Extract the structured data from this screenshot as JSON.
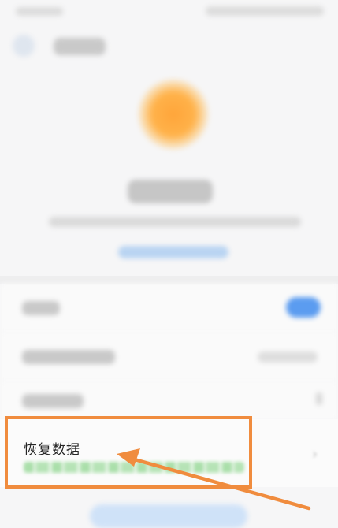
{
  "restore_item": {
    "title": "恢复数据"
  },
  "colors": {
    "accent": "#f08c3e",
    "toggle": "#5b9cf0",
    "sun": "#ffa53a",
    "background": "#f6f6f7"
  },
  "icons": [
    "back-arrow-icon",
    "sun-icon",
    "chevron-right-icon"
  ],
  "toggle_state": "on"
}
